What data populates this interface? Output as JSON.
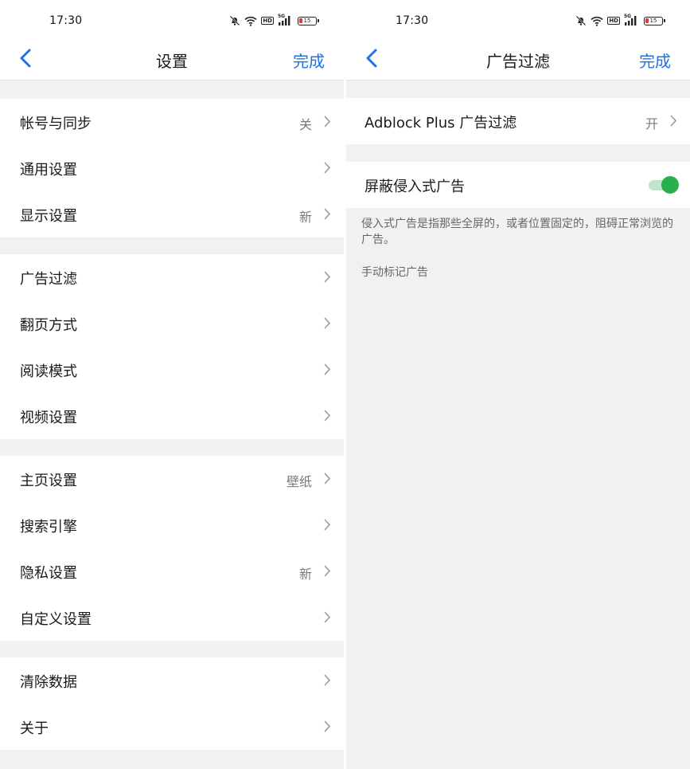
{
  "status": {
    "time": "17:30",
    "battery": "15"
  },
  "left": {
    "back_label": "‹",
    "title": "设置",
    "done": "完成",
    "groups": [
      {
        "rows": [
          {
            "label": "帐号与同步",
            "value": "关"
          },
          {
            "label": "通用设置",
            "value": ""
          },
          {
            "label": "显示设置",
            "value": "新"
          }
        ]
      },
      {
        "rows": [
          {
            "label": "广告过滤",
            "value": ""
          },
          {
            "label": "翻页方式",
            "value": ""
          },
          {
            "label": "阅读模式",
            "value": ""
          },
          {
            "label": "视频设置",
            "value": ""
          }
        ]
      },
      {
        "rows": [
          {
            "label": "主页设置",
            "value": "壁纸"
          },
          {
            "label": "搜索引擎",
            "value": ""
          },
          {
            "label": "隐私设置",
            "value": "新"
          },
          {
            "label": "自定义设置",
            "value": ""
          }
        ]
      },
      {
        "rows": [
          {
            "label": "清除数据",
            "value": ""
          },
          {
            "label": "关于",
            "value": ""
          }
        ]
      }
    ]
  },
  "right": {
    "title": "广告过滤",
    "done": "完成",
    "adblock": {
      "label": "Adblock Plus 广告过滤",
      "value": "开"
    },
    "intrusive": {
      "label": "屏蔽侵入式广告",
      "enabled": true
    },
    "description": "侵入式广告是指那些全屏的，或者位置固定的，阻碍正常浏览的广告。",
    "manual_mark": "手动标记广告"
  },
  "colors": {
    "accent": "#1a73e8",
    "toggle_on": "#27b14b",
    "background": "#f1f1f1"
  }
}
